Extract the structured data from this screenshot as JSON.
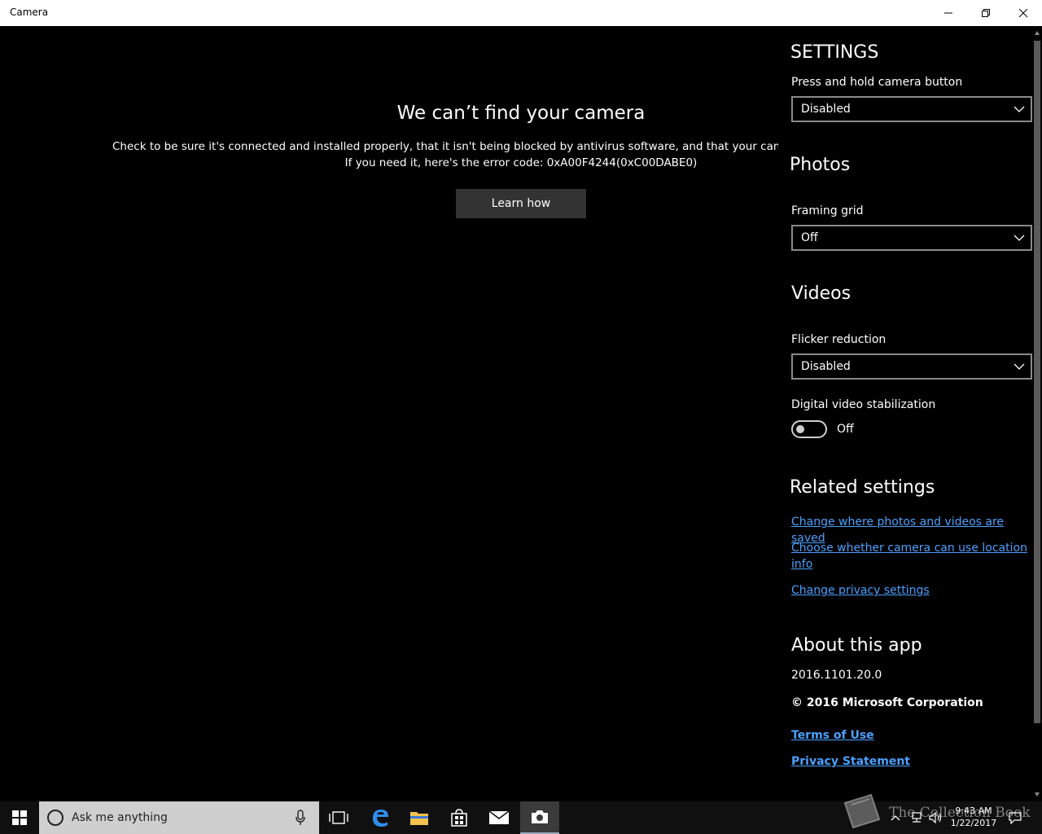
{
  "window": {
    "title": "Camera"
  },
  "error": {
    "title": "We can’t find your camera",
    "description": "Check to be sure it's connected and installed properly, that it isn't being blocked by antivirus software, and that your camera drivers are up-to-date.",
    "code_line": "If you need it, here's the error code: 0xA00F4244(0xC00DABE0)",
    "learn_button": "Learn how"
  },
  "settings": {
    "heading": "SETTINGS",
    "camera_button": {
      "label": "Press and hold camera button",
      "value": "Disabled"
    },
    "photos": {
      "heading": "Photos",
      "framing_grid": {
        "label": "Framing grid",
        "value": "Off"
      }
    },
    "videos": {
      "heading": "Videos",
      "flicker": {
        "label": "Flicker reduction",
        "value": "Disabled"
      },
      "stabilization": {
        "label": "Digital video stabilization",
        "state_text": "Off",
        "on": false
      }
    },
    "related": {
      "heading": "Related settings",
      "links": [
        "Change where photos and videos are saved",
        "Choose whether camera can use location info",
        "Change privacy settings"
      ]
    },
    "about": {
      "heading": "About this app",
      "version": "2016.1101.20.0",
      "copyright": "© 2016 Microsoft Corporation",
      "terms": "Terms of Use",
      "privacy": "Privacy Statement"
    }
  },
  "taskbar": {
    "search_placeholder": "Ask me anything",
    "time": "9:43 AM",
    "date": "1/22/2017",
    "watermark": "The Collection Book",
    "icons": [
      "windows-start-icon",
      "cortana-icon",
      "microphone-icon",
      "task-view-icon",
      "edge-icon",
      "file-explorer-icon",
      "store-icon",
      "mail-icon",
      "camera-icon",
      "tray-chevron-icon",
      "network-icon",
      "volume-icon",
      "notification-icon"
    ]
  },
  "colors": {
    "background": "#000000",
    "link": "#4aa0ff",
    "button": "#333333",
    "taskbar": "#101010",
    "search_box": "#cfcfcf"
  }
}
